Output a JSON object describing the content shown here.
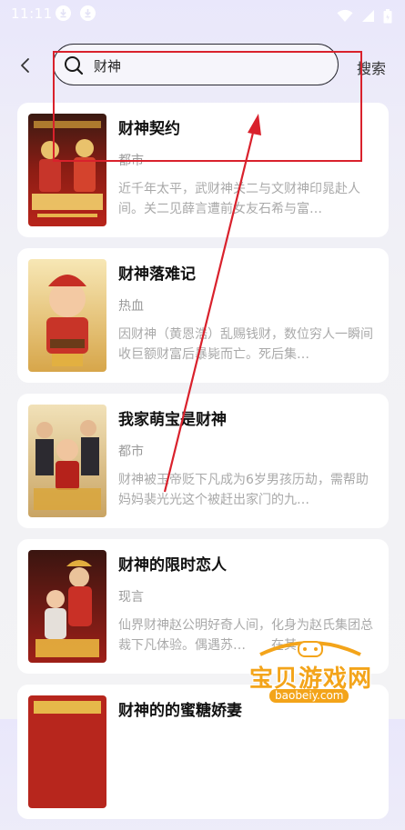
{
  "status_bar": {
    "time": "11:11"
  },
  "header": {
    "search_value": "财神",
    "search_button_label": "搜索"
  },
  "results": [
    {
      "title": "财神契约",
      "genre": "都市",
      "desc": "近千年太平，武财神关二与文财神印晁赴人间。关二见薛言遭前女友石希与富…"
    },
    {
      "title": "财神落难记",
      "genre": "热血",
      "desc": "因财神（黄恩浩）乱赐钱财，数位穷人一瞬间收巨额财富后暴毙而亡。死后集…"
    },
    {
      "title": "我家萌宝是财神",
      "genre": "都市",
      "desc": "财神被玉帝贬下凡成为6岁男孩历劫，需帮助妈妈裴光光这个被赶出家门的九…"
    },
    {
      "title": "财神的限时恋人",
      "genre": "现言",
      "desc": "仙界财神赵公明好奇人间，化身为赵氏集团总裁下凡体验。偶遇苏…　　在其…"
    },
    {
      "title": "财神的的蜜糖娇妻",
      "genre": "",
      "desc": ""
    }
  ],
  "watermark": {
    "text": "宝贝游戏网",
    "url": "baobeiy.com"
  },
  "colors": {
    "annotation": "#d9212c",
    "watermark": "#f3a41a"
  }
}
